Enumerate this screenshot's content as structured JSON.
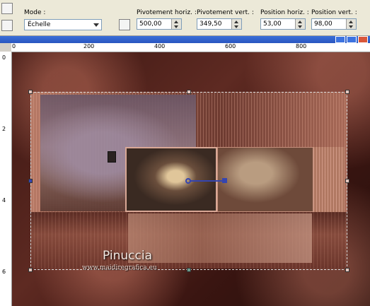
{
  "toolbar": {
    "mode": {
      "label": "Mode :",
      "value": "Échelle"
    },
    "fields": [
      {
        "label": "Pivotement horiz. :",
        "value": "500,00"
      },
      {
        "label": "Pivotement vert. :",
        "value": "349,50"
      },
      {
        "label": "Position horiz. :",
        "value": "53,00"
      },
      {
        "label": "Position vert. :",
        "value": "98,00"
      }
    ]
  },
  "ruler": {
    "h_ticks": [
      "0",
      "200",
      "400",
      "600",
      "800"
    ],
    "v_ticks": [
      "0",
      "2",
      "4",
      "6"
    ]
  },
  "canvas": {
    "signature": "Pinuccia",
    "website": "www.maidiregrafica.eu"
  },
  "colors": {
    "canvas_bg": "#3b1612",
    "frame": "#b77a66",
    "pivot": "#3545b0"
  }
}
